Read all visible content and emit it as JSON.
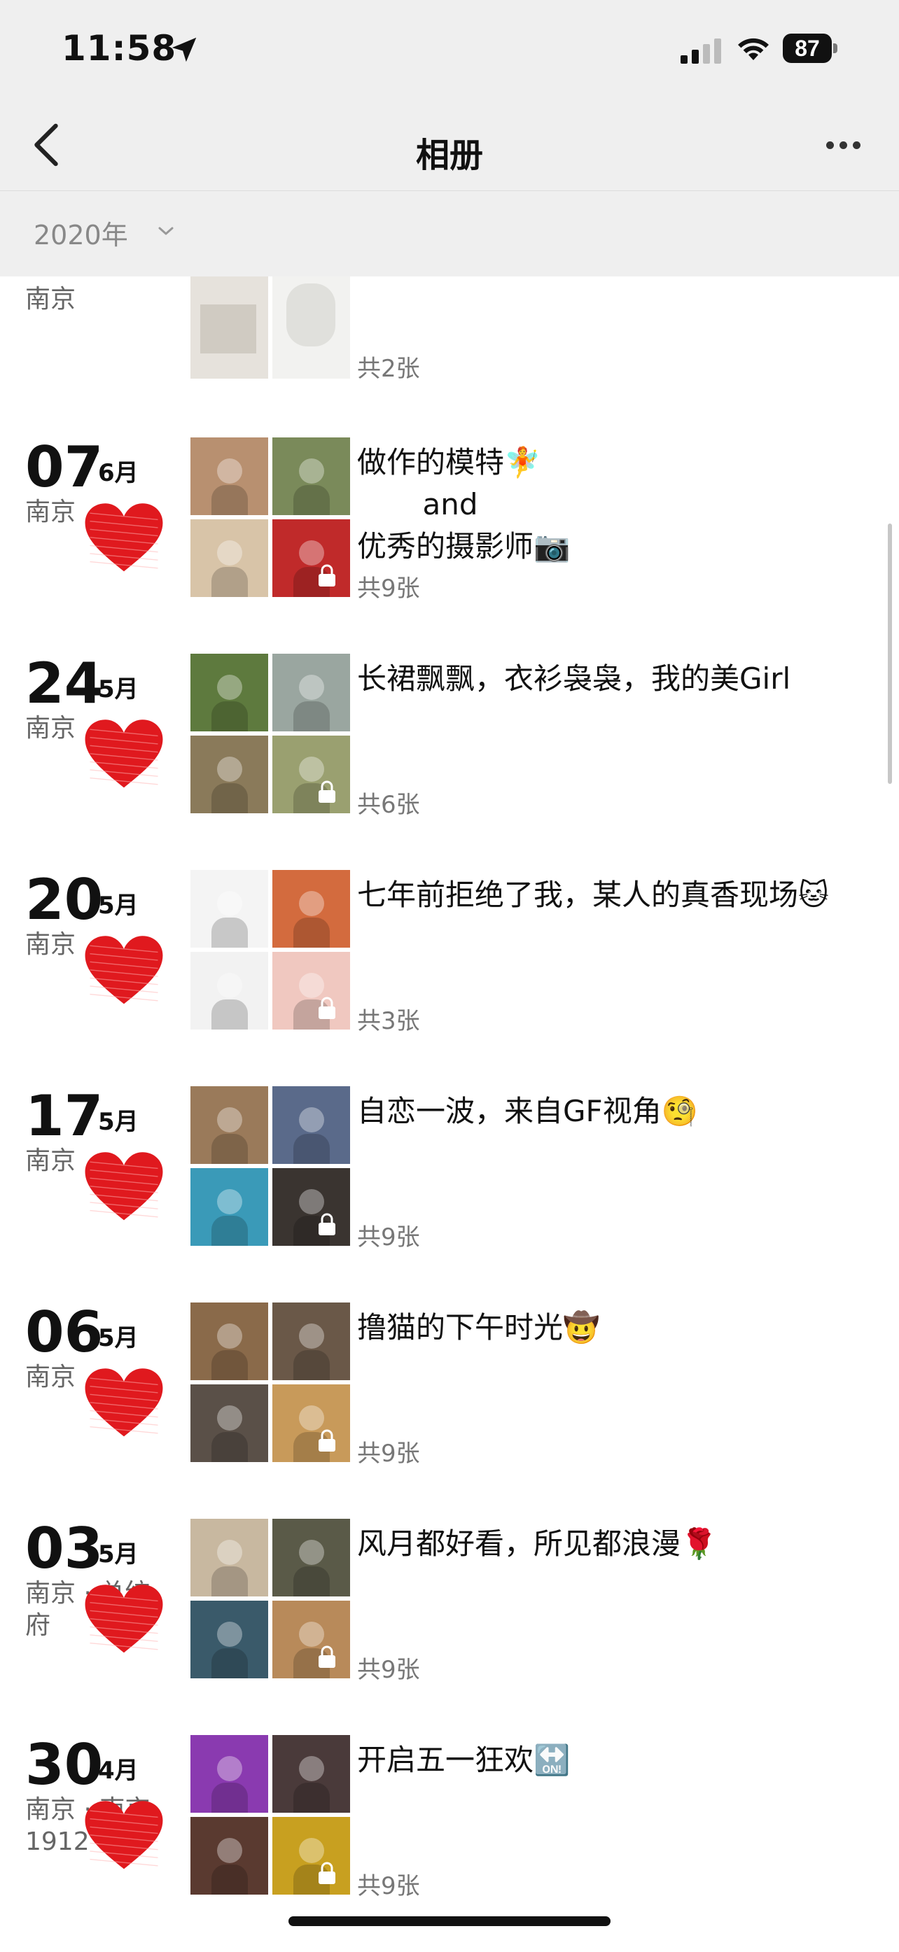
{
  "status": {
    "time": "11:58",
    "battery": "87"
  },
  "nav": {
    "title": "相册"
  },
  "year_filter": {
    "label": "2020年"
  },
  "partial": {
    "place": "南京",
    "count": "共2张"
  },
  "entries": [
    {
      "day": "07",
      "month": "6月",
      "place": "南京",
      "caption": "做作的模特🧚\n       and\n优秀的摄影师📷",
      "count": "共9张",
      "colors": [
        "#b89070",
        "#7a8a5a",
        "#d8c4a8",
        "#c02a2a"
      ]
    },
    {
      "day": "24",
      "month": "5月",
      "place": "南京",
      "caption": "长裙飘飘，衣衫袅袅，我的美Girl",
      "count": "共6张",
      "colors": [
        "#5e7a3e",
        "#9aa6a0",
        "#8a7a5a",
        "#9aa070"
      ]
    },
    {
      "day": "20",
      "month": "5月",
      "place": "南京",
      "caption": "七年前拒绝了我，某人的真香现场🐱",
      "count": "共3张",
      "colors": [
        "#f4f4f4",
        "#d36b3e",
        "#f2f2f2",
        "#f0c8c0"
      ]
    },
    {
      "day": "17",
      "month": "5月",
      "place": "南京",
      "caption": "自恋一波，来自GF视角🧐",
      "count": "共9张",
      "colors": [
        "#9a7a5a",
        "#5a6a8a",
        "#3a9ab8",
        "#3a3430"
      ]
    },
    {
      "day": "06",
      "month": "5月",
      "place": "南京",
      "caption": "撸猫的下午时光🤠",
      "count": "共9张",
      "colors": [
        "#8a6a4a",
        "#6a5848",
        "#5a5048",
        "#c89a5a"
      ]
    },
    {
      "day": "03",
      "month": "5月",
      "place": "南京 · 总统府",
      "caption": "风月都好看，所见都浪漫🌹",
      "count": "共9张",
      "colors": [
        "#c8b8a0",
        "#5a5a48",
        "#3a5a6a",
        "#b88a5a"
      ]
    },
    {
      "day": "30",
      "month": "4月",
      "place": "南京 · 南京1912",
      "caption": "开启五一狂欢🔛",
      "count": "共9张",
      "colors": [
        "#8a3ab0",
        "#4a3a3a",
        "#5a3a30",
        "#c8a020"
      ]
    }
  ],
  "colors": {
    "bar_bg": "#efefef",
    "heart": "#e0191e",
    "meta_text": "#777777"
  },
  "icons": [
    "back-chevron-icon",
    "more-icon",
    "location-arrow-icon",
    "signal-icon",
    "wifi-icon",
    "battery-icon",
    "heart-icon",
    "lock-icon",
    "chevron-down-icon"
  ]
}
